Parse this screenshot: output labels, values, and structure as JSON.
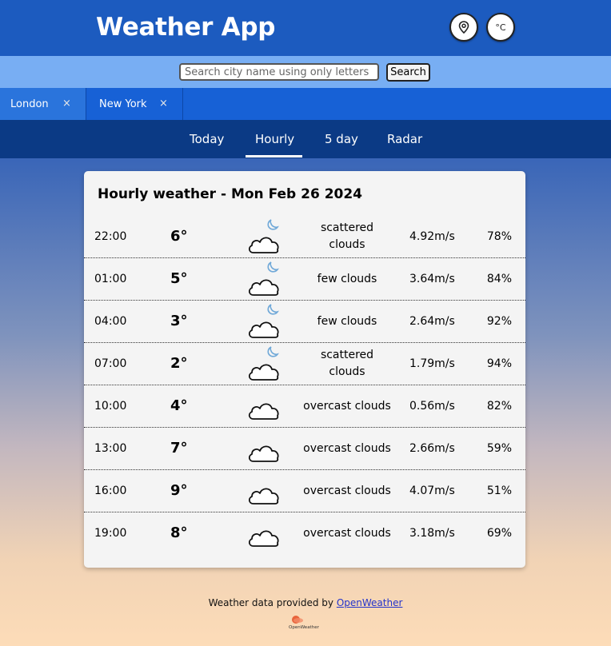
{
  "header": {
    "title": "Weather App",
    "location_button_icon": "map-pin-icon",
    "unit_button_label": "°C"
  },
  "search": {
    "placeholder": "Search city name using only letters",
    "value": "",
    "button_label": "Search"
  },
  "city_tabs": [
    {
      "label": "London",
      "close": "×"
    },
    {
      "label": "New York",
      "close": "×"
    }
  ],
  "view_tabs": {
    "today": "Today",
    "hourly": "Hourly",
    "five_day": "5 day",
    "radar": "Radar",
    "active": "Hourly"
  },
  "card": {
    "title": "Hourly weather - Mon Feb 26 2024",
    "rows": [
      {
        "time": "22:00",
        "temp": "6°",
        "icon": "cloud-moon-icon",
        "desc": "scattered clouds",
        "wind": "4.92m/s",
        "humidity": "78%"
      },
      {
        "time": "01:00",
        "temp": "5°",
        "icon": "cloud-moon-icon",
        "desc": "few clouds",
        "wind": "3.64m/s",
        "humidity": "84%"
      },
      {
        "time": "04:00",
        "temp": "3°",
        "icon": "cloud-moon-icon",
        "desc": "few clouds",
        "wind": "2.64m/s",
        "humidity": "92%"
      },
      {
        "time": "07:00",
        "temp": "2°",
        "icon": "cloud-moon-icon",
        "desc": "scattered clouds",
        "wind": "1.79m/s",
        "humidity": "94%"
      },
      {
        "time": "10:00",
        "temp": "4°",
        "icon": "cloud-icon",
        "desc": "overcast clouds",
        "wind": "0.56m/s",
        "humidity": "82%"
      },
      {
        "time": "13:00",
        "temp": "7°",
        "icon": "cloud-icon",
        "desc": "overcast clouds",
        "wind": "2.66m/s",
        "humidity": "59%"
      },
      {
        "time": "16:00",
        "temp": "9°",
        "icon": "cloud-icon",
        "desc": "overcast clouds",
        "wind": "4.07m/s",
        "humidity": "51%"
      },
      {
        "time": "19:00",
        "temp": "8°",
        "icon": "cloud-icon",
        "desc": "overcast clouds",
        "wind": "3.18m/s",
        "humidity": "69%"
      }
    ]
  },
  "footer": {
    "text": "Weather data provided by ",
    "link_label": "OpenWeather",
    "logo_text": "OpenWeather"
  },
  "colors": {
    "header_bg": "#1c5bbf",
    "search_bg": "#78aef3",
    "citytabs_bg": "#1761d6",
    "viewtabs_bg": "#0b3a85",
    "card_bg": "#f4f4f4",
    "moon_color": "#6fa8d8",
    "logo_color": "#e8643c"
  }
}
